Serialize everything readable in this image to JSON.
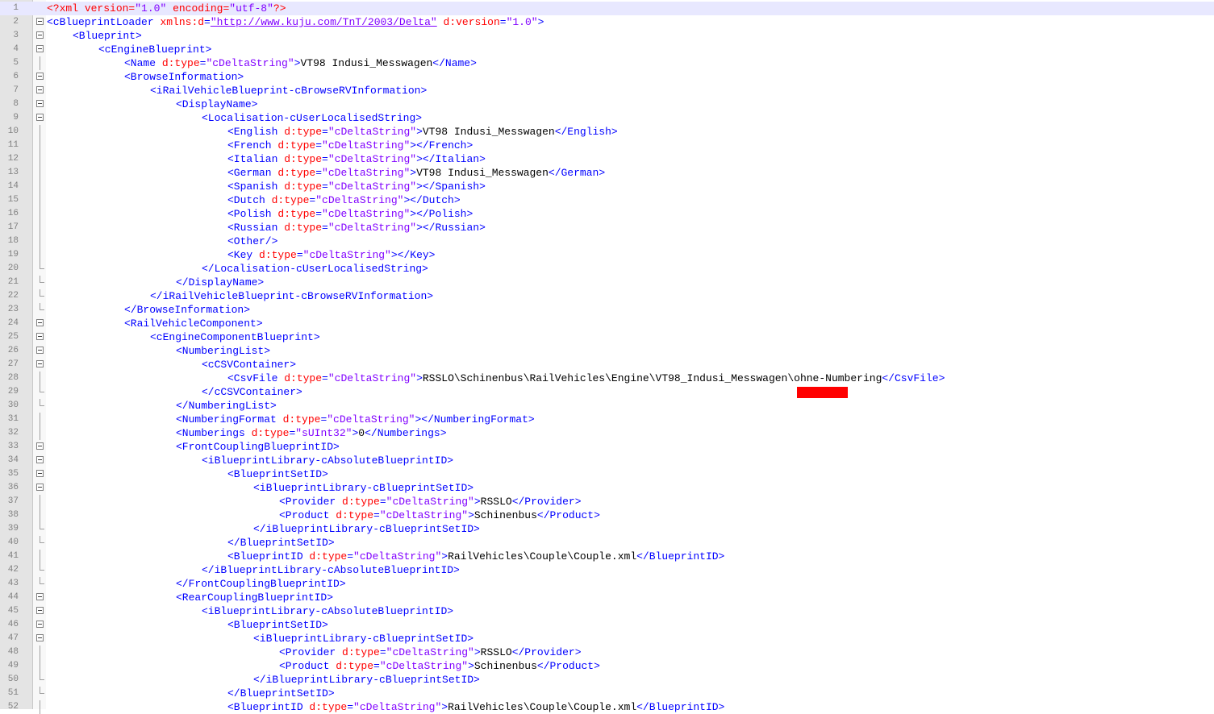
{
  "editor": {
    "language": "XML",
    "current_line": 1,
    "lines": [
      {
        "n": "1",
        "indent": 0,
        "fold": "none",
        "tokens": [
          [
            "pi",
            "<?xml "
          ],
          [
            "attr",
            "version"
          ],
          [
            "pi",
            "="
          ],
          [
            "val",
            "\"1.0\""
          ],
          [
            "pi",
            " "
          ],
          [
            "attr",
            "encoding"
          ],
          [
            "pi",
            "="
          ],
          [
            "val",
            "\"utf-8\""
          ],
          [
            "pi",
            "?>"
          ]
        ]
      },
      {
        "n": "2",
        "indent": 0,
        "fold": "open",
        "tokens": [
          [
            "tag",
            "<cBlueprintLoader "
          ],
          [
            "attr",
            "xmlns:d"
          ],
          [
            "tag",
            "="
          ],
          [
            "url",
            "\"http://www.kuju.com/TnT/2003/Delta\""
          ],
          [
            "tag",
            " "
          ],
          [
            "attr",
            "d:version"
          ],
          [
            "tag",
            "="
          ],
          [
            "val",
            "\"1.0\""
          ],
          [
            "tag",
            ">"
          ]
        ]
      },
      {
        "n": "3",
        "indent": 1,
        "fold": "open",
        "tokens": [
          [
            "tag",
            "<Blueprint>"
          ]
        ]
      },
      {
        "n": "4",
        "indent": 2,
        "fold": "open",
        "tokens": [
          [
            "tag",
            "<cEngineBlueprint>"
          ]
        ]
      },
      {
        "n": "5",
        "indent": 3,
        "fold": "line",
        "tokens": [
          [
            "tag",
            "<Name "
          ],
          [
            "attr",
            "d:type"
          ],
          [
            "tag",
            "="
          ],
          [
            "val",
            "\"cDeltaString\""
          ],
          [
            "tag",
            ">"
          ],
          [
            "text",
            "VT98 Indusi_Messwagen"
          ],
          [
            "tag",
            "</Name>"
          ]
        ]
      },
      {
        "n": "6",
        "indent": 3,
        "fold": "open",
        "tokens": [
          [
            "tag",
            "<BrowseInformation>"
          ]
        ]
      },
      {
        "n": "7",
        "indent": 4,
        "fold": "open",
        "tokens": [
          [
            "tag",
            "<iRailVehicleBlueprint-cBrowseRVInformation>"
          ]
        ]
      },
      {
        "n": "8",
        "indent": 5,
        "fold": "open",
        "tokens": [
          [
            "tag",
            "<DisplayName>"
          ]
        ]
      },
      {
        "n": "9",
        "indent": 6,
        "fold": "open",
        "tokens": [
          [
            "tag",
            "<Localisation-cUserLocalisedString>"
          ]
        ]
      },
      {
        "n": "10",
        "indent": 7,
        "fold": "line",
        "tokens": [
          [
            "tag",
            "<English "
          ],
          [
            "attr",
            "d:type"
          ],
          [
            "tag",
            "="
          ],
          [
            "val",
            "\"cDeltaString\""
          ],
          [
            "tag",
            ">"
          ],
          [
            "text",
            "VT98 Indusi_Messwagen"
          ],
          [
            "tag",
            "</English>"
          ]
        ]
      },
      {
        "n": "11",
        "indent": 7,
        "fold": "line",
        "tokens": [
          [
            "tag",
            "<French "
          ],
          [
            "attr",
            "d:type"
          ],
          [
            "tag",
            "="
          ],
          [
            "val",
            "\"cDeltaString\""
          ],
          [
            "tag",
            "></French>"
          ]
        ]
      },
      {
        "n": "12",
        "indent": 7,
        "fold": "line",
        "tokens": [
          [
            "tag",
            "<Italian "
          ],
          [
            "attr",
            "d:type"
          ],
          [
            "tag",
            "="
          ],
          [
            "val",
            "\"cDeltaString\""
          ],
          [
            "tag",
            "></Italian>"
          ]
        ]
      },
      {
        "n": "13",
        "indent": 7,
        "fold": "line",
        "tokens": [
          [
            "tag",
            "<German "
          ],
          [
            "attr",
            "d:type"
          ],
          [
            "tag",
            "="
          ],
          [
            "val",
            "\"cDeltaString\""
          ],
          [
            "tag",
            ">"
          ],
          [
            "text",
            "VT98 Indusi_Messwagen"
          ],
          [
            "tag",
            "</German>"
          ]
        ]
      },
      {
        "n": "14",
        "indent": 7,
        "fold": "line",
        "tokens": [
          [
            "tag",
            "<Spanish "
          ],
          [
            "attr",
            "d:type"
          ],
          [
            "tag",
            "="
          ],
          [
            "val",
            "\"cDeltaString\""
          ],
          [
            "tag",
            "></Spanish>"
          ]
        ]
      },
      {
        "n": "15",
        "indent": 7,
        "fold": "line",
        "tokens": [
          [
            "tag",
            "<Dutch "
          ],
          [
            "attr",
            "d:type"
          ],
          [
            "tag",
            "="
          ],
          [
            "val",
            "\"cDeltaString\""
          ],
          [
            "tag",
            "></Dutch>"
          ]
        ]
      },
      {
        "n": "16",
        "indent": 7,
        "fold": "line",
        "tokens": [
          [
            "tag",
            "<Polish "
          ],
          [
            "attr",
            "d:type"
          ],
          [
            "tag",
            "="
          ],
          [
            "val",
            "\"cDeltaString\""
          ],
          [
            "tag",
            "></Polish>"
          ]
        ]
      },
      {
        "n": "17",
        "indent": 7,
        "fold": "line",
        "tokens": [
          [
            "tag",
            "<Russian "
          ],
          [
            "attr",
            "d:type"
          ],
          [
            "tag",
            "="
          ],
          [
            "val",
            "\"cDeltaString\""
          ],
          [
            "tag",
            "></Russian>"
          ]
        ]
      },
      {
        "n": "18",
        "indent": 7,
        "fold": "line",
        "tokens": [
          [
            "tag",
            "<Other/>"
          ]
        ]
      },
      {
        "n": "19",
        "indent": 7,
        "fold": "line",
        "tokens": [
          [
            "tag",
            "<Key "
          ],
          [
            "attr",
            "d:type"
          ],
          [
            "tag",
            "="
          ],
          [
            "val",
            "\"cDeltaString\""
          ],
          [
            "tag",
            "></Key>"
          ]
        ]
      },
      {
        "n": "20",
        "indent": 6,
        "fold": "end",
        "tokens": [
          [
            "tag",
            "</Localisation-cUserLocalisedString>"
          ]
        ]
      },
      {
        "n": "21",
        "indent": 5,
        "fold": "end",
        "tokens": [
          [
            "tag",
            "</DisplayName>"
          ]
        ]
      },
      {
        "n": "22",
        "indent": 4,
        "fold": "end",
        "tokens": [
          [
            "tag",
            "</iRailVehicleBlueprint-cBrowseRVInformation>"
          ]
        ]
      },
      {
        "n": "23",
        "indent": 3,
        "fold": "end",
        "tokens": [
          [
            "tag",
            "</BrowseInformation>"
          ]
        ]
      },
      {
        "n": "24",
        "indent": 3,
        "fold": "open",
        "tokens": [
          [
            "tag",
            "<RailVehicleComponent>"
          ]
        ]
      },
      {
        "n": "25",
        "indent": 4,
        "fold": "open",
        "tokens": [
          [
            "tag",
            "<cEngineComponentBlueprint>"
          ]
        ]
      },
      {
        "n": "26",
        "indent": 5,
        "fold": "open",
        "tokens": [
          [
            "tag",
            "<NumberingList>"
          ]
        ]
      },
      {
        "n": "27",
        "indent": 6,
        "fold": "open",
        "tokens": [
          [
            "tag",
            "<cCSVContainer>"
          ]
        ]
      },
      {
        "n": "28",
        "indent": 7,
        "fold": "line",
        "tokens": [
          [
            "tag",
            "<CsvFile "
          ],
          [
            "attr",
            "d:type"
          ],
          [
            "tag",
            "="
          ],
          [
            "val",
            "\"cDeltaString\""
          ],
          [
            "tag",
            ">"
          ],
          [
            "text",
            "RSSLO\\Schinenbus\\RailVehicles\\Engine\\VT98_Indusi_Messwagen\\ohne-Numbering"
          ],
          [
            "tag",
            "</CsvFile>"
          ]
        ]
      },
      {
        "n": "29",
        "indent": 6,
        "fold": "end",
        "tokens": [
          [
            "tag",
            "</cCSVContainer>"
          ]
        ]
      },
      {
        "n": "30",
        "indent": 5,
        "fold": "end",
        "tokens": [
          [
            "tag",
            "</NumberingList>"
          ]
        ]
      },
      {
        "n": "31",
        "indent": 5,
        "fold": "line",
        "tokens": [
          [
            "tag",
            "<NumberingFormat "
          ],
          [
            "attr",
            "d:type"
          ],
          [
            "tag",
            "="
          ],
          [
            "val",
            "\"cDeltaString\""
          ],
          [
            "tag",
            "></NumberingFormat>"
          ]
        ]
      },
      {
        "n": "32",
        "indent": 5,
        "fold": "line",
        "tokens": [
          [
            "tag",
            "<Numberings "
          ],
          [
            "attr",
            "d:type"
          ],
          [
            "tag",
            "="
          ],
          [
            "val",
            "\"sUInt32\""
          ],
          [
            "tag",
            ">"
          ],
          [
            "text",
            "0"
          ],
          [
            "tag",
            "</Numberings>"
          ]
        ]
      },
      {
        "n": "33",
        "indent": 5,
        "fold": "open",
        "tokens": [
          [
            "tag",
            "<FrontCouplingBlueprintID>"
          ]
        ]
      },
      {
        "n": "34",
        "indent": 6,
        "fold": "open",
        "tokens": [
          [
            "tag",
            "<iBlueprintLibrary-cAbsoluteBlueprintID>"
          ]
        ]
      },
      {
        "n": "35",
        "indent": 7,
        "fold": "open",
        "tokens": [
          [
            "tag",
            "<BlueprintSetID>"
          ]
        ]
      },
      {
        "n": "36",
        "indent": 8,
        "fold": "open",
        "tokens": [
          [
            "tag",
            "<iBlueprintLibrary-cBlueprintSetID>"
          ]
        ]
      },
      {
        "n": "37",
        "indent": 9,
        "fold": "line",
        "tokens": [
          [
            "tag",
            "<Provider "
          ],
          [
            "attr",
            "d:type"
          ],
          [
            "tag",
            "="
          ],
          [
            "val",
            "\"cDeltaString\""
          ],
          [
            "tag",
            ">"
          ],
          [
            "text",
            "RSSLO"
          ],
          [
            "tag",
            "</Provider>"
          ]
        ]
      },
      {
        "n": "38",
        "indent": 9,
        "fold": "line",
        "tokens": [
          [
            "tag",
            "<Product "
          ],
          [
            "attr",
            "d:type"
          ],
          [
            "tag",
            "="
          ],
          [
            "val",
            "\"cDeltaString\""
          ],
          [
            "tag",
            ">"
          ],
          [
            "text",
            "Schinenbus"
          ],
          [
            "tag",
            "</Product>"
          ]
        ]
      },
      {
        "n": "39",
        "indent": 8,
        "fold": "end",
        "tokens": [
          [
            "tag",
            "</iBlueprintLibrary-cBlueprintSetID>"
          ]
        ]
      },
      {
        "n": "40",
        "indent": 7,
        "fold": "end",
        "tokens": [
          [
            "tag",
            "</BlueprintSetID>"
          ]
        ]
      },
      {
        "n": "41",
        "indent": 7,
        "fold": "line",
        "tokens": [
          [
            "tag",
            "<BlueprintID "
          ],
          [
            "attr",
            "d:type"
          ],
          [
            "tag",
            "="
          ],
          [
            "val",
            "\"cDeltaString\""
          ],
          [
            "tag",
            ">"
          ],
          [
            "text",
            "RailVehicles\\Couple\\Couple.xml"
          ],
          [
            "tag",
            "</BlueprintID>"
          ]
        ]
      },
      {
        "n": "42",
        "indent": 6,
        "fold": "end",
        "tokens": [
          [
            "tag",
            "</iBlueprintLibrary-cAbsoluteBlueprintID>"
          ]
        ]
      },
      {
        "n": "43",
        "indent": 5,
        "fold": "end",
        "tokens": [
          [
            "tag",
            "</FrontCouplingBlueprintID>"
          ]
        ]
      },
      {
        "n": "44",
        "indent": 5,
        "fold": "open",
        "tokens": [
          [
            "tag",
            "<RearCouplingBlueprintID>"
          ]
        ]
      },
      {
        "n": "45",
        "indent": 6,
        "fold": "open",
        "tokens": [
          [
            "tag",
            "<iBlueprintLibrary-cAbsoluteBlueprintID>"
          ]
        ]
      },
      {
        "n": "46",
        "indent": 7,
        "fold": "open",
        "tokens": [
          [
            "tag",
            "<BlueprintSetID>"
          ]
        ]
      },
      {
        "n": "47",
        "indent": 8,
        "fold": "open",
        "tokens": [
          [
            "tag",
            "<iBlueprintLibrary-cBlueprintSetID>"
          ]
        ]
      },
      {
        "n": "48",
        "indent": 9,
        "fold": "line",
        "tokens": [
          [
            "tag",
            "<Provider "
          ],
          [
            "attr",
            "d:type"
          ],
          [
            "tag",
            "="
          ],
          [
            "val",
            "\"cDeltaString\""
          ],
          [
            "tag",
            ">"
          ],
          [
            "text",
            "RSSLO"
          ],
          [
            "tag",
            "</Provider>"
          ]
        ]
      },
      {
        "n": "49",
        "indent": 9,
        "fold": "line",
        "tokens": [
          [
            "tag",
            "<Product "
          ],
          [
            "attr",
            "d:type"
          ],
          [
            "tag",
            "="
          ],
          [
            "val",
            "\"cDeltaString\""
          ],
          [
            "tag",
            ">"
          ],
          [
            "text",
            "Schinenbus"
          ],
          [
            "tag",
            "</Product>"
          ]
        ]
      },
      {
        "n": "50",
        "indent": 8,
        "fold": "end",
        "tokens": [
          [
            "tag",
            "</iBlueprintLibrary-cBlueprintSetID>"
          ]
        ]
      },
      {
        "n": "51",
        "indent": 7,
        "fold": "end",
        "tokens": [
          [
            "tag",
            "</BlueprintSetID>"
          ]
        ]
      },
      {
        "n": "52",
        "indent": 7,
        "fold": "line",
        "tokens": [
          [
            "tag",
            "<BlueprintID "
          ],
          [
            "attr",
            "d:type"
          ],
          [
            "tag",
            "="
          ],
          [
            "val",
            "\"cDeltaString\""
          ],
          [
            "tag",
            ">"
          ],
          [
            "text",
            "RailVehicles\\Couple\\Couple.xml"
          ],
          [
            "tag",
            "</BlueprintID>"
          ]
        ]
      }
    ]
  },
  "colors": {
    "tag": "#0000ff",
    "attr": "#ff0000",
    "value": "#8000ff",
    "text": "#000000",
    "redaction": "#ff0000"
  }
}
